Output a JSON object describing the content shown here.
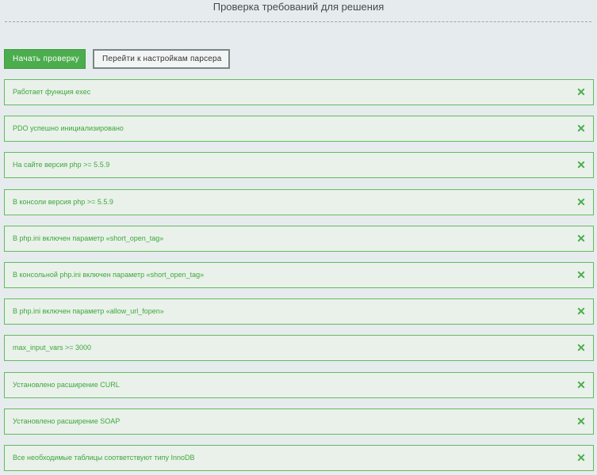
{
  "header": {
    "title": "Проверка требований для решения"
  },
  "actions": {
    "start_label": "Начать проверку",
    "settings_label": "Перейти к настройкам парсера"
  },
  "colors": {
    "success_text": "#3fa73d",
    "success_border": "#63bb5f",
    "primary_button": "#4cad4e"
  },
  "checks": [
    {
      "label": "Работает функция exec",
      "icon": "close-icon"
    },
    {
      "label": "PDO успешно инициализировано",
      "icon": "close-icon"
    },
    {
      "label": "На сайте версия php >= 5.5.9",
      "icon": "close-icon"
    },
    {
      "label": "В консоли версия php >= 5.5.9",
      "icon": "close-icon"
    },
    {
      "label": "В php.ini включен параметр «short_open_tag»",
      "icon": "close-icon"
    },
    {
      "label": "В консольной php.ini включен параметр «short_open_tag»",
      "icon": "close-icon"
    },
    {
      "label": "В php.ini включен параметр «allow_url_fopen»",
      "icon": "close-icon"
    },
    {
      "label": "max_input_vars >= 3000",
      "icon": "close-icon"
    },
    {
      "label": "Установлено расширение CURL",
      "icon": "close-icon"
    },
    {
      "label": "Установлено расширение SOAP",
      "icon": "close-icon"
    },
    {
      "label": "Все необходимые таблицы соответствуют типу InnoDB",
      "icon": "close-icon"
    }
  ]
}
